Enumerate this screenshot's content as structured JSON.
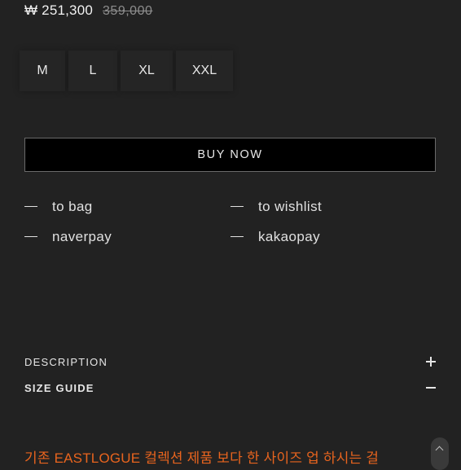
{
  "price": {
    "current": "₩ 251,300",
    "original": "359,000"
  },
  "sizes": [
    {
      "label": "M"
    },
    {
      "label": "L"
    },
    {
      "label": "XL"
    },
    {
      "label": "XXL"
    }
  ],
  "buy_button": {
    "label": "BUY NOW"
  },
  "actions": [
    {
      "label": "to bag"
    },
    {
      "label": "to wishlist"
    },
    {
      "label": "naverpay"
    },
    {
      "label": "kakaopay"
    }
  ],
  "accordion": {
    "description": {
      "label": "DESCRIPTION",
      "icon": "plus-icon"
    },
    "size_guide": {
      "label": "SIZE GUIDE",
      "icon": "minus-icon"
    }
  },
  "size_guide_text": "기존 EASTLOGUE 컬렉션 제품 보다 한 사이즈 업 하시는 걸",
  "scroll_top": {
    "icon": "chevron-up-icon"
  },
  "colors": {
    "background": "#222222",
    "accent_text": "#e8641e",
    "button_bg": "#000000"
  }
}
